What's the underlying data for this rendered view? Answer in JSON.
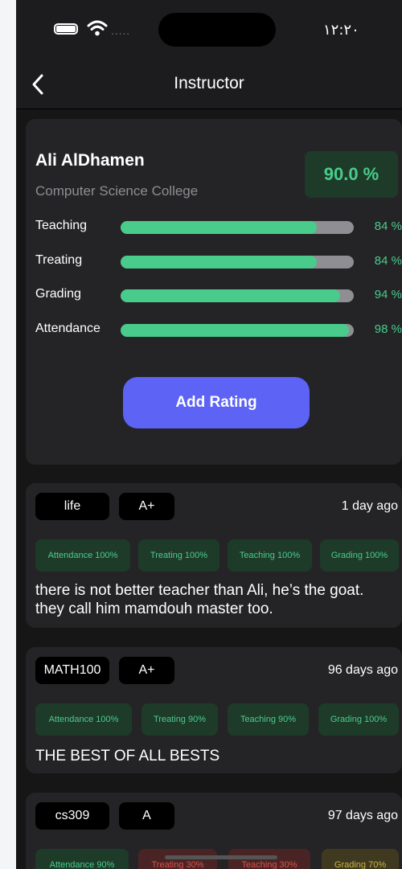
{
  "status_bar": {
    "time": "١٢:٢٠",
    "signal_dots": "....."
  },
  "nav": {
    "title": "Instructor"
  },
  "instructor": {
    "name": "Ali AlDhamen",
    "college": "Computer Science College",
    "overall": "90.0 %",
    "ratings": [
      {
        "label": "Teaching",
        "value": 84,
        "display": "84 %"
      },
      {
        "label": "Treating",
        "value": 84,
        "display": "84 %"
      },
      {
        "label": "Grading",
        "value": 94,
        "display": "94 %"
      },
      {
        "label": "Attendance",
        "value": 98,
        "display": "98 %"
      }
    ],
    "add_button": "Add Rating"
  },
  "reviews": [
    {
      "course": "life",
      "grade": "A+",
      "time": "1 day ago",
      "tags": [
        "Attendance 100%",
        "Treating 100%",
        "Teaching 100%",
        "Grading 100%"
      ],
      "comment": "there is not better teacher than Ali, he’s the goat. they call him mamdouh master too."
    },
    {
      "course": "MATH100",
      "grade": "A+",
      "time": "96 days ago",
      "tags": [
        "Attendance 100%",
        "Treating 90%",
        "Teaching 90%",
        "Grading 100%"
      ],
      "comment": "THE BEST OF ALL BESTS"
    },
    {
      "course": "cs309",
      "grade": "A",
      "time": "97 days ago",
      "tags": [
        "Attendance 90%",
        "Treating 30%",
        "Teaching 30%",
        "Grading 70%"
      ],
      "comment": ""
    }
  ],
  "colors": {
    "accent": "#5c63f5",
    "good": "#49cc8b",
    "bad": "#d9534f",
    "mid": "#c9b24a",
    "card": "#242426"
  }
}
